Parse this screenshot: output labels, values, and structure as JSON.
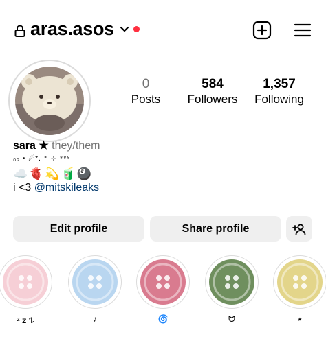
{
  "header": {
    "username": "aras.asos",
    "icons": [
      "lock-icon",
      "chevron-down-icon",
      "notification-dot",
      "new-post-icon",
      "menu-icon"
    ]
  },
  "stats": {
    "posts": {
      "count": "0",
      "label": "Posts"
    },
    "followers": {
      "count": "584",
      "label": "Followers"
    },
    "following": {
      "count": "1,357",
      "label": "Following"
    }
  },
  "bio": {
    "name": "sara ★",
    "pronouns": "they/them",
    "line1": "₀₃ • ☄*. ⁺ ⊹ ⁸⁸⁸",
    "line2": "☁️🫀💫🧃🎱",
    "line3_prefix": "i <3 ",
    "mention": "@mitskileaks"
  },
  "buttons": {
    "edit": "Edit profile",
    "share": "Share profile",
    "add_icon": "add-person-icon"
  },
  "highlights": [
    {
      "label": "ᶻ 𝗓 𐰁",
      "color": "#f6cfd6"
    },
    {
      "label": "♪",
      "color": "#b9d6f0"
    },
    {
      "label": "🌀",
      "color": "#d97b8f"
    },
    {
      "label": "ᗢ",
      "color": "#6f8f5e"
    },
    {
      "label": "⭑",
      "color": "#e3d58a"
    }
  ],
  "colors": {
    "notification": "#ff3040",
    "mention": "#00376b",
    "button_bg": "#efefef",
    "muted": "#737373"
  }
}
